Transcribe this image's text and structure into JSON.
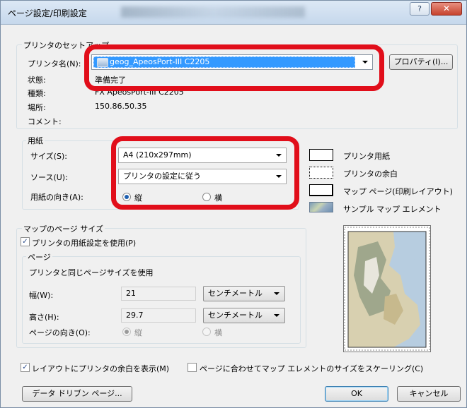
{
  "window": {
    "title": "ページ設定/印刷設定",
    "help_glyph": "?",
    "close_glyph": "✕"
  },
  "printer_setup": {
    "group_title": "プリンタのセットアップ",
    "name_label": "プリンタ名(N):",
    "name_value": "geog_ApeosPort-III C2205",
    "properties_button": "プロパティ(I)...",
    "status_label": "状態:",
    "status_value": "準備完了",
    "type_label": "種類:",
    "type_value": "FX ApeosPort-III C2205",
    "location_label": "場所:",
    "location_value": "150.86.50.35",
    "comment_label": "コメント:"
  },
  "paper": {
    "group_title": "用紙",
    "size_label": "サイズ(S):",
    "size_value": "A4 (210x297mm)",
    "source_label": "ソース(U):",
    "source_value": "プリンタの設定に従う",
    "orientation_label": "用紙の向き(A):",
    "portrait_label": "縦",
    "landscape_label": "横",
    "orientation_selected": "portrait"
  },
  "legend": {
    "printer_paper": "プリンタ用紙",
    "printer_margin": "プリンタの余白",
    "map_page": "マップ ページ(印刷レイアウト)",
    "sample_element": "サンプル マップ エレメント"
  },
  "map_page_size": {
    "group_title": "マップのページ サイズ",
    "use_printer_paper_label": "プリンタの用紙設定を使用(P)",
    "use_printer_paper_checked": true,
    "page_group_title": "ページ",
    "same_size_text": "プリンタと同じページサイズを使用",
    "width_label": "幅(W):",
    "width_value": "21",
    "width_unit": "センチメートル",
    "height_label": "高さ(H):",
    "height_value": "29.7",
    "height_unit": "センチメートル",
    "page_orientation_label": "ページの向き(O):",
    "portrait_label": "縦",
    "landscape_label": "横"
  },
  "options": {
    "show_printer_margins_label": "レイアウトにプリンタの余白を表示(M)",
    "show_printer_margins_checked": true,
    "scale_elements_label": "ページに合わせてマップ エレメントのサイズをスケーリング(C)",
    "scale_elements_checked": false
  },
  "buttons": {
    "data_driven": "データ ドリブン ページ...",
    "ok": "OK",
    "cancel": "キャンセル"
  },
  "colors": {
    "highlight_red": "#e10e1a",
    "selection_blue": "#3399ff"
  }
}
